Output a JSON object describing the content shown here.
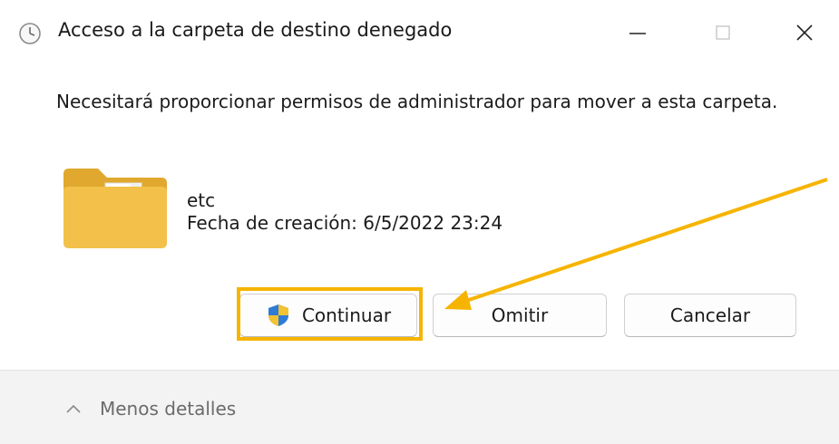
{
  "window": {
    "title": "Acceso a la carpeta de destino denegado",
    "controls": {
      "minimize_icon": "minimize-icon",
      "maximize_icon": "maximize-icon",
      "close_icon": "close-icon"
    }
  },
  "message": "Necesitará proporcionar permisos de administrador para mover a esta carpeta.",
  "item": {
    "icon": "folder-icon",
    "name": "etc",
    "created": "Fecha de creación: 6/5/2022 23:24"
  },
  "buttons": {
    "continue": {
      "label": "Continuar",
      "icon": "uac-shield-icon"
    },
    "skip": {
      "label": "Omitir"
    },
    "cancel": {
      "label": "Cancelar"
    }
  },
  "footer": {
    "details_toggle": "Menos detalles"
  },
  "colors": {
    "highlight": "#f6b400",
    "arrow": "#f6b400",
    "folder": "#f3c14a",
    "footer_bg": "#f3f3f3"
  }
}
